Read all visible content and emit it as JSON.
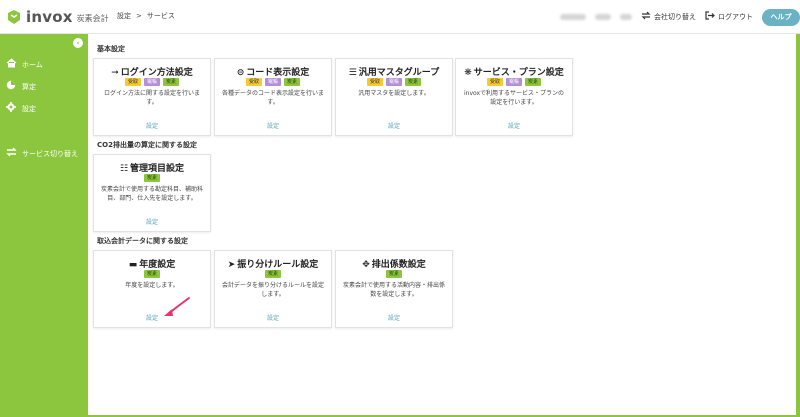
{
  "header": {
    "logo_text": "invox",
    "logo_sub": "炭素会計",
    "breadcrumb": [
      "設定",
      ">",
      "サービス"
    ],
    "switch_company": "会社切り替え",
    "logout": "ログアウト",
    "help": "ヘルプ"
  },
  "sidebar": {
    "items": [
      {
        "label": "ホーム",
        "icon": "home-icon"
      },
      {
        "label": "算定",
        "icon": "pie-chart-icon"
      },
      {
        "label": "設定",
        "icon": "gear-icon"
      },
      {
        "label": "サービス切り替え",
        "icon": "switch-icon"
      }
    ]
  },
  "sections": [
    {
      "title": "基本設定",
      "cards": [
        {
          "title": "ログイン方法設定",
          "icon": "login-icon",
          "tags": [
            "受取",
            "電帳",
            "炭素"
          ],
          "desc": "ログイン方法に関する設定を行います。",
          "link": "設定"
        },
        {
          "title": "コード表示設定",
          "icon": "minus-circle-icon",
          "tags": [
            "受取",
            "電帳",
            "炭素"
          ],
          "desc": "各種データのコード表示設定を行います。",
          "link": "設定"
        },
        {
          "title": "汎用マスタグループ",
          "icon": "list-icon",
          "tags": [
            "受取",
            "電帳",
            "炭素"
          ],
          "desc": "汎用マスタを設定します。",
          "link": "設定"
        },
        {
          "title": "サービス・プラン設定",
          "icon": "gear-icon",
          "tags": [
            "受取",
            "電帳",
            "炭素"
          ],
          "desc": "invoxで利用するサービス・プランの設定を行います。",
          "link": "設定"
        }
      ]
    },
    {
      "title": "CO2排出量の算定に関する設定",
      "cards": [
        {
          "title": "管理項目設定",
          "icon": "sitemap-icon",
          "tags": [
            "炭素"
          ],
          "desc": "炭素会計で使用する勘定科目、補助科目、部門、仕入先を設定します。",
          "link": "設定"
        }
      ]
    },
    {
      "title": "取込会計データに関する設定",
      "cards": [
        {
          "title": "年度設定",
          "icon": "calendar-icon",
          "tags": [
            "炭素"
          ],
          "desc": "年度を設定します。",
          "link": "設定"
        },
        {
          "title": "振り分けルール設定",
          "icon": "branch-icon",
          "tags": [
            "炭素"
          ],
          "desc": "会計データを振り分けるルールを設定します。",
          "link": "設定"
        },
        {
          "title": "排出係数設定",
          "icon": "grid-icon",
          "tags": [
            "炭素"
          ],
          "desc": "炭素会計で使用する活動内容・排出係数を設定します。",
          "link": "設定"
        }
      ]
    }
  ],
  "colors": {
    "brand_green": "#8cc63f",
    "help_button": "#6bb3c4",
    "link": "#5aa6b8",
    "tag_yellow": "#f6c935",
    "tag_purple": "#b48fd6",
    "annotation_arrow": "#e8336f"
  }
}
